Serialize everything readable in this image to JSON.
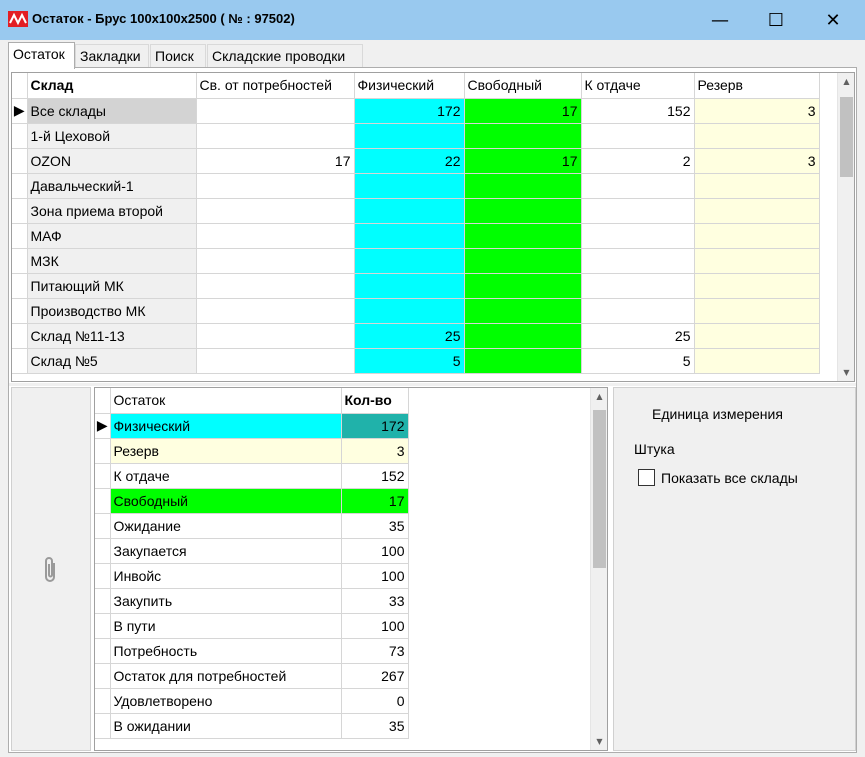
{
  "window": {
    "title": "Остаток - Брус 100x100x2500 ( № : 97502)",
    "controls": {
      "minimize": "—",
      "maximize": "☐",
      "close": "✕"
    }
  },
  "tabs": [
    "Остаток",
    "Закладки",
    "Поиск",
    "Складские проводки"
  ],
  "active_tab": "Остаток",
  "stock_grid": {
    "columns": [
      "Склад",
      "Св. от потребностей",
      "Физический",
      "Свободный",
      "К отдаче",
      "Резерв"
    ],
    "rows": [
      {
        "name": "Все склады",
        "sv": "",
        "fiz": "172",
        "svob": "17",
        "otdache": "152",
        "rezerv": "3",
        "selected": true
      },
      {
        "name": "1-й Цеховой",
        "sv": "",
        "fiz": "",
        "svob": "",
        "otdache": "",
        "rezerv": ""
      },
      {
        "name": "OZON",
        "sv": "17",
        "fiz": "22",
        "svob": "17",
        "otdache": "2",
        "rezerv": "3"
      },
      {
        "name": "Давальческий-1",
        "sv": "",
        "fiz": "",
        "svob": "",
        "otdache": "",
        "rezerv": ""
      },
      {
        "name": "Зона приема второй",
        "sv": "",
        "fiz": "",
        "svob": "",
        "otdache": "",
        "rezerv": ""
      },
      {
        "name": "МАФ",
        "sv": "",
        "fiz": "",
        "svob": "",
        "otdache": "",
        "rezerv": ""
      },
      {
        "name": "МЗК",
        "sv": "",
        "fiz": "",
        "svob": "",
        "otdache": "",
        "rezerv": ""
      },
      {
        "name": "Питающий МК",
        "sv": "",
        "fiz": "",
        "svob": "",
        "otdache": "",
        "rezerv": ""
      },
      {
        "name": "Производство МК",
        "sv": "",
        "fiz": "",
        "svob": "",
        "otdache": "",
        "rezerv": ""
      },
      {
        "name": "Склад №11-13",
        "sv": "",
        "fiz": "25",
        "svob": "",
        "otdache": "25",
        "rezerv": ""
      },
      {
        "name": "Склад №5",
        "sv": "",
        "fiz": "5",
        "svob": "",
        "otdache": "5",
        "rezerv": ""
      }
    ]
  },
  "summary_grid": {
    "columns": [
      "Остаток",
      "Кол-во"
    ],
    "rows": [
      {
        "label": "Физический",
        "value": "172",
        "style": "fiz",
        "selected": true
      },
      {
        "label": "Резерв",
        "value": "3",
        "style": "rez"
      },
      {
        "label": "К отдаче",
        "value": "152",
        "style": ""
      },
      {
        "label": "Свободный",
        "value": "17",
        "style": "svob"
      },
      {
        "label": "Ожидание",
        "value": "35",
        "style": ""
      },
      {
        "label": "Закупается",
        "value": "100",
        "style": ""
      },
      {
        "label": "Инвойс",
        "value": "100",
        "style": ""
      },
      {
        "label": "Закупить",
        "value": "33",
        "style": ""
      },
      {
        "label": "В пути",
        "value": "100",
        "style": ""
      },
      {
        "label": "Потребность",
        "value": "73",
        "style": ""
      },
      {
        "label": "Остаток для потребностей",
        "value": "267",
        "style": ""
      },
      {
        "label": "Удовлетворено",
        "value": "0",
        "style": ""
      },
      {
        "label": "В ожидании",
        "value": "35",
        "style": ""
      }
    ]
  },
  "right_panel": {
    "unit_label": "Единица измерения",
    "unit_value": "Штука",
    "show_all_label": "Показать все склады",
    "show_all_checked": false
  },
  "colors": {
    "titlebar": "#99c9ef",
    "fiz": "#00ffff",
    "svob": "#00ff00",
    "rez": "#ffffe0",
    "fiz_selected": "#20b2aa"
  },
  "icons": [
    "app-logo-icon",
    "paperclip-icon",
    "row-pointer-icon"
  ]
}
